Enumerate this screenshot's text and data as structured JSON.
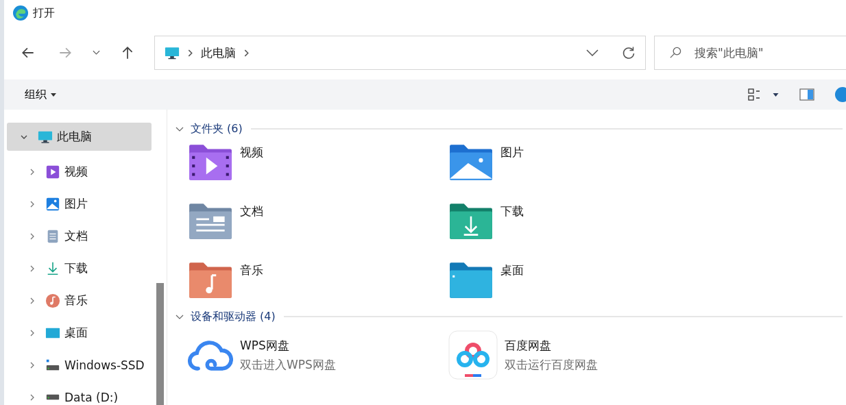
{
  "window": {
    "title": "打开"
  },
  "nav": {
    "breadcrumb": [
      "此电脑"
    ],
    "search": {
      "placeholder": "搜索\"此电脑\""
    }
  },
  "toolbar": {
    "organize": "组织"
  },
  "sidebar": {
    "items": [
      {
        "label": "此电脑",
        "kind": "pc",
        "expanded": true,
        "selected": true,
        "children": [
          {
            "label": "视频",
            "kind": "video",
            "expanded": false,
            "selected": false
          },
          {
            "label": "图片",
            "kind": "pictures",
            "expanded": false,
            "selected": false
          },
          {
            "label": "文档",
            "kind": "documents",
            "expanded": false,
            "selected": false
          },
          {
            "label": "下载",
            "kind": "downloads",
            "expanded": false,
            "selected": false
          },
          {
            "label": "音乐",
            "kind": "music",
            "expanded": false,
            "selected": false
          },
          {
            "label": "桌面",
            "kind": "desktop",
            "expanded": false,
            "selected": false
          },
          {
            "label": "Windows-SSD",
            "kind": "system-drive",
            "expanded": false,
            "selected": false
          },
          {
            "label": "Data (D:)",
            "kind": "drive",
            "expanded": false,
            "selected": false
          }
        ]
      }
    ]
  },
  "content": {
    "groups": [
      {
        "title": "文件夹 (6)",
        "expanded": true,
        "items": [
          {
            "name": "视频",
            "kind": "video",
            "selected": false
          },
          {
            "name": "图片",
            "kind": "pictures",
            "selected": false
          },
          {
            "name": "文档",
            "kind": "documents",
            "selected": false
          },
          {
            "name": "下载",
            "kind": "downloads",
            "selected": false
          },
          {
            "name": "音乐",
            "kind": "music",
            "selected": false
          },
          {
            "name": "桌面",
            "kind": "desktop",
            "selected": false
          }
        ]
      },
      {
        "title": "设备和驱动器 (4)",
        "expanded": true,
        "items": [
          {
            "name": "WPS网盘",
            "subtitle": "双击进入WPS网盘",
            "kind": "cloud",
            "selected": false
          },
          {
            "name": "百度网盘",
            "subtitle": "双击运行百度网盘",
            "kind": "app",
            "selected": false
          }
        ]
      }
    ]
  }
}
